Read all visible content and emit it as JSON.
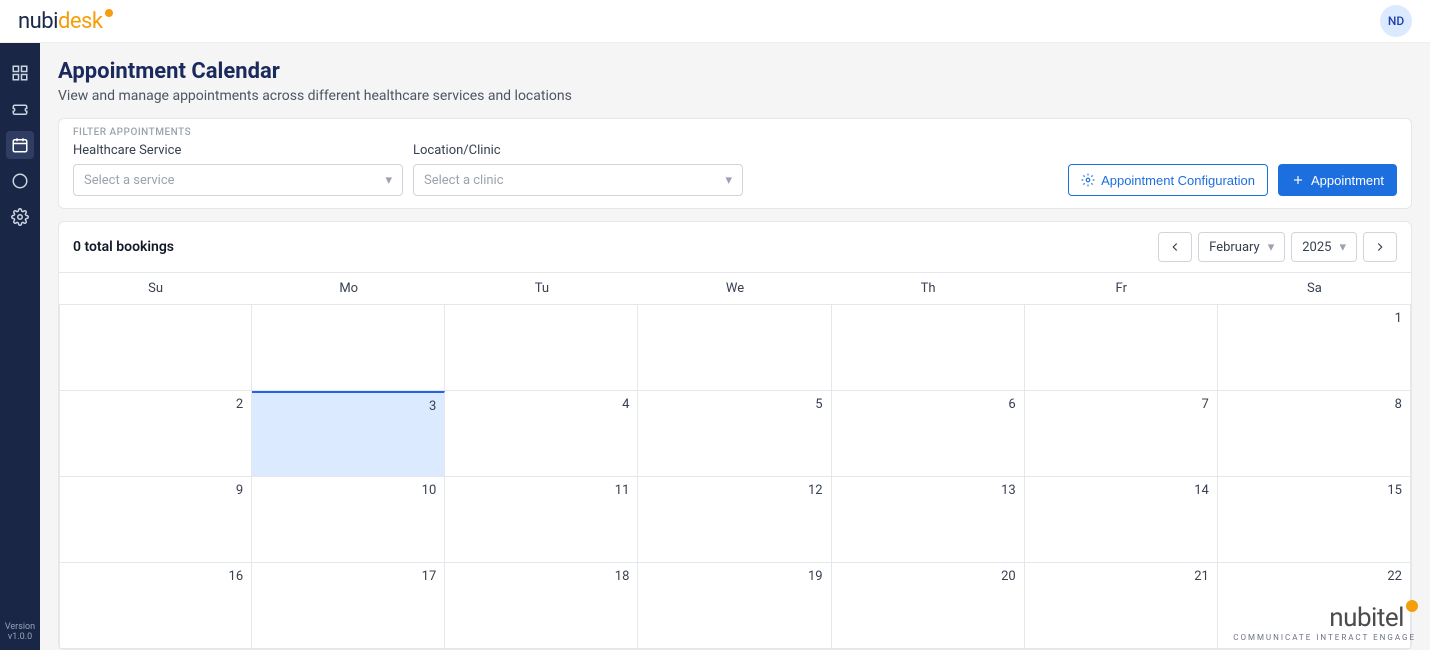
{
  "header": {
    "brand": "nubidesk",
    "avatar_initials": "ND"
  },
  "sidebar": {
    "items": [
      {
        "name": "dashboard",
        "icon": "grid"
      },
      {
        "name": "tickets",
        "icon": "ticket"
      },
      {
        "name": "calendar",
        "icon": "calendar",
        "active": true
      },
      {
        "name": "loading",
        "icon": "circle"
      },
      {
        "name": "settings",
        "icon": "gear"
      }
    ],
    "version_label": "Version",
    "version_value": "v1.0.0"
  },
  "page": {
    "title": "Appointment Calendar",
    "subtitle": "View and manage appointments across different healthcare services and locations"
  },
  "filters": {
    "legend": "FILTER APPOINTMENTS",
    "service_label": "Healthcare Service",
    "service_placeholder": "Select a service",
    "clinic_label": "Location/Clinic",
    "clinic_placeholder": "Select a clinic"
  },
  "actions": {
    "config_label": "Appointment Configuration",
    "new_label": "Appointment"
  },
  "calendar": {
    "bookings_text": "0 total bookings",
    "month_value": "February",
    "year_value": "2025",
    "day_headers": [
      "Su",
      "Mo",
      "Tu",
      "We",
      "Th",
      "Fr",
      "Sa"
    ],
    "weeks": [
      [
        "",
        "",
        "",
        "",
        "",
        "",
        "1"
      ],
      [
        "2",
        "3",
        "4",
        "5",
        "6",
        "7",
        "8"
      ],
      [
        "9",
        "10",
        "11",
        "12",
        "13",
        "14",
        "15"
      ],
      [
        "16",
        "17",
        "18",
        "19",
        "20",
        "21",
        "22"
      ]
    ],
    "today": "3"
  },
  "footer": {
    "brand": "nubitel",
    "tagline": "COMMUNICATE INTERACT ENGAGE"
  }
}
